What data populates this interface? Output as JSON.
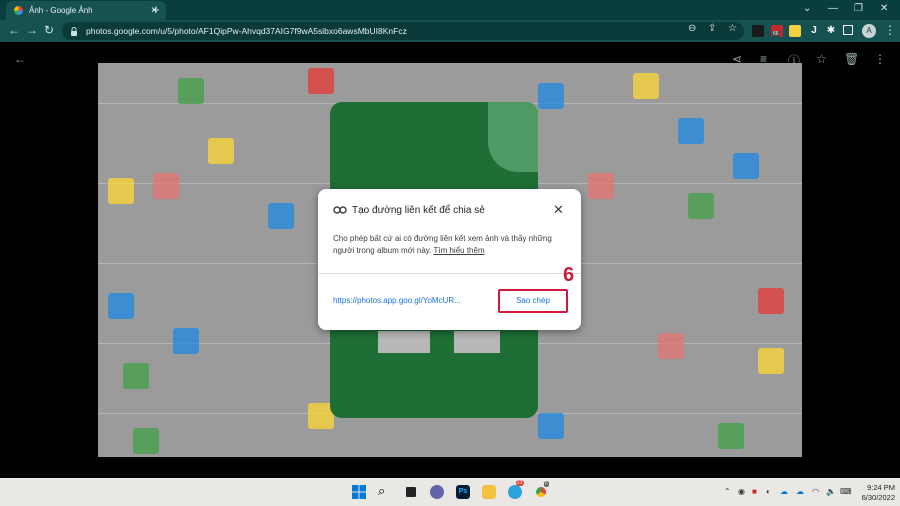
{
  "browser": {
    "tab_title": "Ảnh - Google Ảnh",
    "new_tab_label": "+",
    "url": "photos.google.com/u/5/photo/AF1QipPw-Ahvqd37AIG7f9wA5sibxo6awsMbUI8KnFcz",
    "profile_initial": "A",
    "extension_badge": "66"
  },
  "dialog": {
    "title": "Tạo đường liên kết để chia sẻ",
    "description": "Cho phép bất cứ ai có đường liên kết xem ảnh và thấy những người trong album mới này.",
    "learn_more": "Tìm hiểu thêm",
    "share_link": "https://photos.app.goo.gl/YoMcUR...",
    "copy_button": "Sao chép",
    "close_icon": "close-icon"
  },
  "annotation": {
    "step_number": "6",
    "highlight_color": "#d0193a"
  },
  "taskbar": {
    "time": "9:24 PM",
    "date": "6/30/2022",
    "telegram_badge": "23",
    "chrome_badge": "6"
  },
  "colors": {
    "titlebar": "#0a3d3d",
    "toolbar": "#165252",
    "link_blue": "#1a73e8",
    "sheets_green": "#1f6e36"
  }
}
